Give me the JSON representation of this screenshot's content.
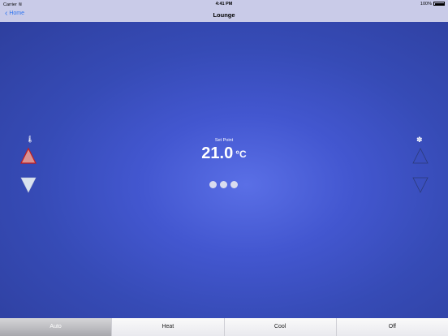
{
  "status": {
    "carrier": "Carrier",
    "time": "4:41 PM",
    "battery": "100%"
  },
  "nav": {
    "back_label": "Home",
    "title": "Lounge"
  },
  "thermostat": {
    "label": "Set Point",
    "value": "21.0",
    "unit": "°C"
  },
  "icons": {
    "thermometer": "thermometer-icon",
    "fan": "fan-icon"
  },
  "tabs": [
    {
      "label": "Auto",
      "active": true
    },
    {
      "label": "Heat",
      "active": false
    },
    {
      "label": "Cool",
      "active": false
    },
    {
      "label": "Off",
      "active": false
    }
  ],
  "colors": {
    "accent": "#2e74f0",
    "up_active_fill": "#d99393",
    "up_active_stroke": "#c41e1e",
    "down_fill": "#d9e2ef"
  }
}
